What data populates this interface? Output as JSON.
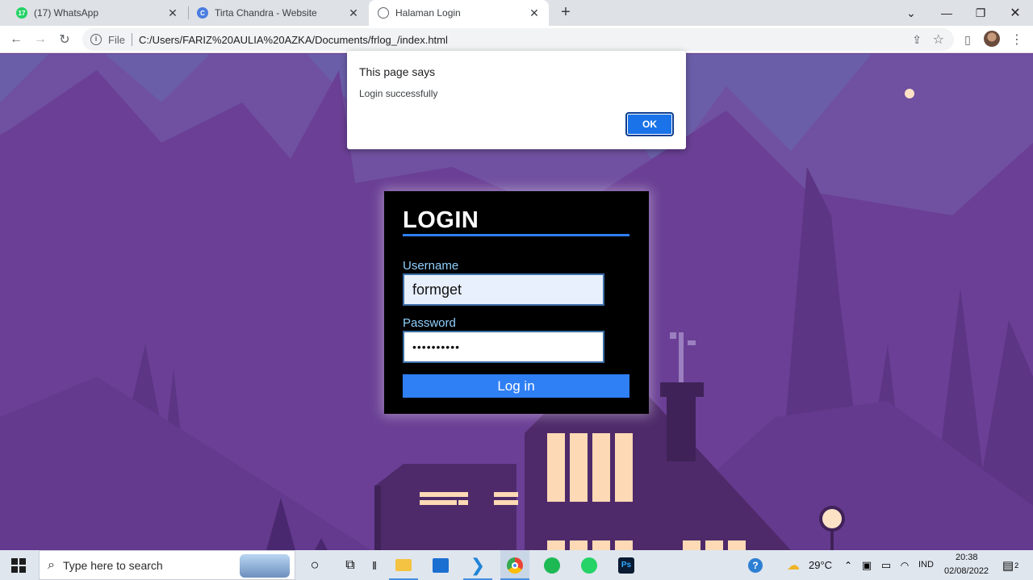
{
  "browser": {
    "tabs": [
      {
        "title": "(17) WhatsApp",
        "badge": "17",
        "color": "#25d366"
      },
      {
        "title": "Tirta Chandra - Website",
        "badge": "C",
        "color": "#4a7de0"
      },
      {
        "title": "Halaman Login",
        "badge": "",
        "color": "#5f6368"
      }
    ],
    "active_tab": 2,
    "address_prefix": "File",
    "url": "C:/Users/FARIZ%20AULIA%20AZKA/Documents/frlog_/index.html"
  },
  "dialog": {
    "title": "This page says",
    "message": "Login successfully",
    "ok_label": "OK"
  },
  "login": {
    "heading": "LOGIN",
    "username_label": "Username",
    "username_value": "formget",
    "password_label": "Password",
    "password_mask": "••••••••••",
    "submit_label": "Log in"
  },
  "taskbar": {
    "search_placeholder": "Type here to search",
    "temperature": "29°C",
    "language": "IND",
    "time": "20:38",
    "date": "02/08/2022",
    "notification_count": "2"
  },
  "colors": {
    "accent": "#2f7ff5",
    "label": "#8fd0ff",
    "sky": "#6b5fa8",
    "window_light": "#fdd9b5"
  }
}
